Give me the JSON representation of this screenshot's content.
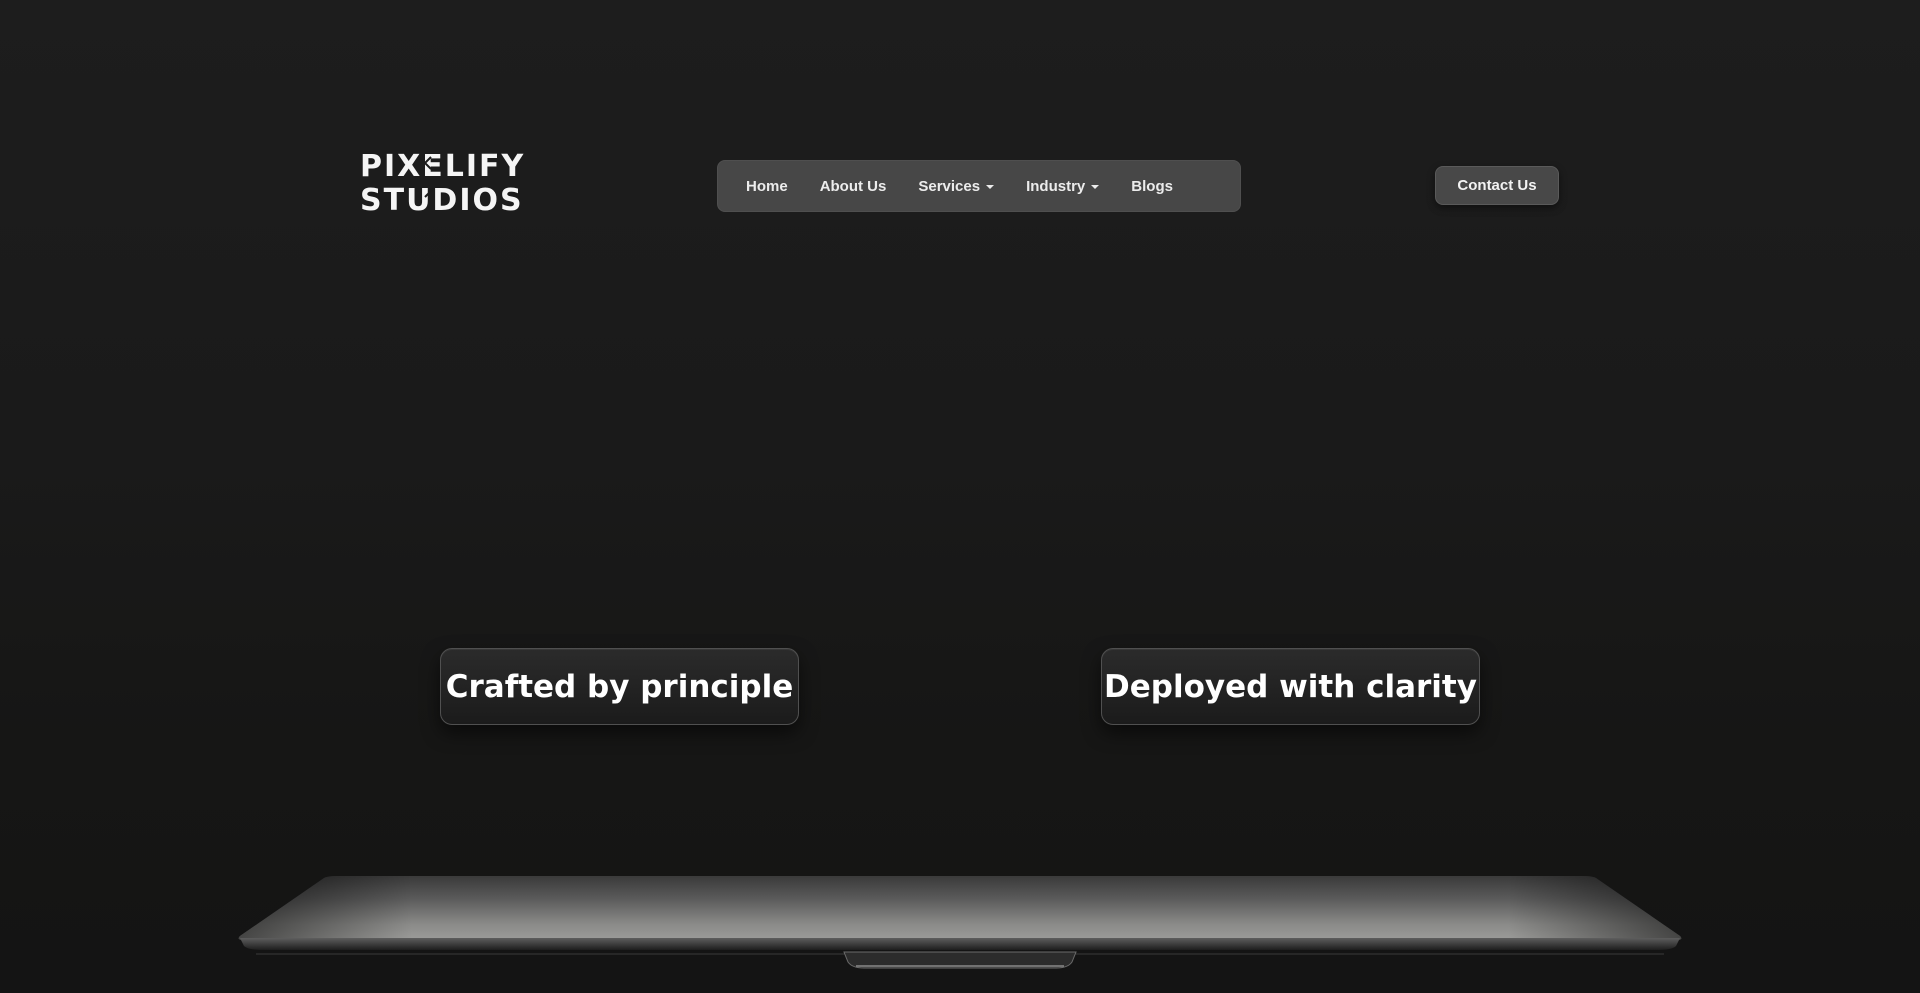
{
  "logo": {
    "line1": "PIXELIFY",
    "line2": "STUDIOS"
  },
  "nav": {
    "items": [
      {
        "label": "Home",
        "dropdown": false
      },
      {
        "label": "About Us",
        "dropdown": false
      },
      {
        "label": "Services",
        "dropdown": true
      },
      {
        "label": "Industry",
        "dropdown": true
      },
      {
        "label": "Blogs",
        "dropdown": false
      }
    ]
  },
  "header": {
    "contact_label": "Contact Us"
  },
  "hero": {
    "tag_left": "Crafted by principle",
    "tag_right": "Deployed with clarity"
  },
  "colors": {
    "background": "#1b1b1b",
    "nav_bg": "#474747",
    "button_bg": "#484848",
    "text": "#ffffff"
  }
}
